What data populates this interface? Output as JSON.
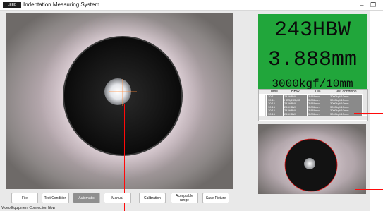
{
  "window": {
    "logo_text": "LEEB",
    "title": "Indentation Measuring System",
    "minimize_glyph": "–",
    "maximize_glyph": "❐"
  },
  "readout": {
    "hardness": "243HBW",
    "diameter": "3.888mm",
    "load": "3000kgf/10mm"
  },
  "results_table": {
    "headers": [
      "Time",
      "HBW",
      "Dia",
      "Test condition"
    ],
    "rows": [
      [
        "10:11",
        "243HBW",
        "3.888mm",
        "3000kgf/10mm"
      ],
      [
        "10:11",
        "HBS(243)HB",
        "3.888mm",
        "3000kgf/10mm"
      ],
      [
        "10:16",
        "243HBW",
        "3.888mm",
        "3000kgf/10mm"
      ],
      [
        "10:16",
        "243HBW",
        "3.888mm",
        "3000kgf/10mm"
      ],
      [
        "10:16",
        "243HBW",
        "3.888mm",
        "3000kgf/10mm"
      ],
      [
        "10:16",
        "243HBW",
        "3.888mm",
        "3000kgf/10mm"
      ]
    ]
  },
  "toolbar": {
    "file": "File",
    "test_condition": "Test Condition",
    "automatic": "Automatic",
    "manual": "Manual",
    "calibration": "Calibration",
    "acceptable_range_line1": "Acceptable",
    "acceptable_range_line2": "range",
    "save_picture": "Save Picture"
  },
  "status_bar": {
    "text": "Video Equipment Connection Now"
  },
  "colors": {
    "readout_background": "#21a63b",
    "leader_line": "#ff0a0a",
    "crosshair": "#ff8a3a",
    "active_button": "#8f8f8f"
  }
}
